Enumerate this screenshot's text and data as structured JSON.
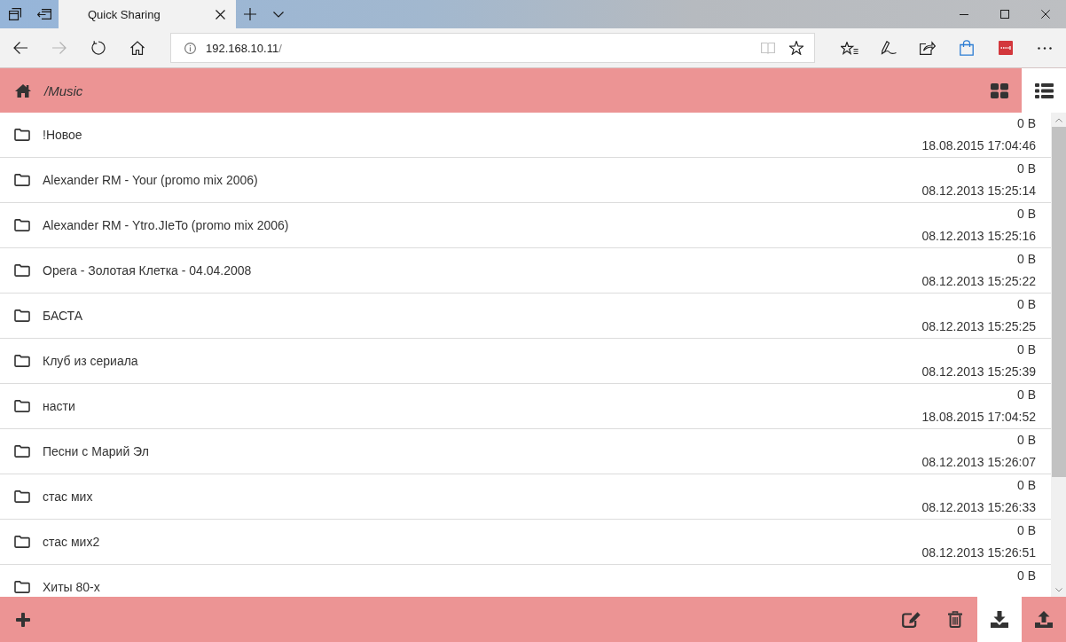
{
  "browser": {
    "tabs": [
      {
        "title": "Quick Sharing",
        "selected": true
      }
    ],
    "nav": [
      {
        "kind": "back",
        "disabled": false
      },
      {
        "kind": "forward",
        "disabled": true
      },
      {
        "kind": "refresh",
        "disabled": false
      },
      {
        "kind": "home",
        "disabled": false
      }
    ],
    "address": {
      "host": "192.168.10.11",
      "path": "/"
    },
    "address_actions": [
      {
        "kind": "reading",
        "disabled": true
      },
      {
        "kind": "favorite",
        "disabled": false
      }
    ],
    "tools": [
      {
        "kind": "favorites"
      },
      {
        "kind": "notes"
      },
      {
        "kind": "share"
      },
      {
        "kind": "store"
      },
      {
        "kind": "extension"
      },
      {
        "kind": "more"
      }
    ]
  },
  "header": {
    "path": "/Music",
    "view_modes": [
      {
        "kind": "grid",
        "selected": false
      },
      {
        "kind": "list",
        "selected": true
      }
    ]
  },
  "files": [
    {
      "name": "!Новое",
      "size": "0 B",
      "modified": "18.08.2015 17:04:46"
    },
    {
      "name": "Alexander RM - Your (promo mix 2006)",
      "size": "0 B",
      "modified": "08.12.2013 15:25:14"
    },
    {
      "name": "Alexander RM - Ytro.JIeTo (promo mix 2006)",
      "size": "0 B",
      "modified": "08.12.2013 15:25:16"
    },
    {
      "name": "Opera - Золотая Клетка - 04.04.2008",
      "size": "0 B",
      "modified": "08.12.2013 15:25:22"
    },
    {
      "name": "БАСТА",
      "size": "0 B",
      "modified": "08.12.2013 15:25:25"
    },
    {
      "name": "Клуб из сериала",
      "size": "0 B",
      "modified": "08.12.2013 15:25:39"
    },
    {
      "name": "насти",
      "size": "0 B",
      "modified": "18.08.2015 17:04:52"
    },
    {
      "name": "Песни с Марий Эл",
      "size": "0 B",
      "modified": "08.12.2013 15:26:07"
    },
    {
      "name": "стас мих",
      "size": "0 B",
      "modified": "08.12.2013 15:26:33"
    },
    {
      "name": "стас мих2",
      "size": "0 B",
      "modified": "08.12.2013 15:26:51"
    },
    {
      "name": "Хиты 80-х",
      "size": "0 B"
    }
  ],
  "footer": {
    "actions": [
      {
        "kind": "add",
        "selected": false
      },
      {
        "kind": "edit",
        "selected": false
      },
      {
        "kind": "delete",
        "selected": false
      },
      {
        "kind": "download",
        "selected": true
      },
      {
        "kind": "upload",
        "selected": false
      }
    ]
  }
}
